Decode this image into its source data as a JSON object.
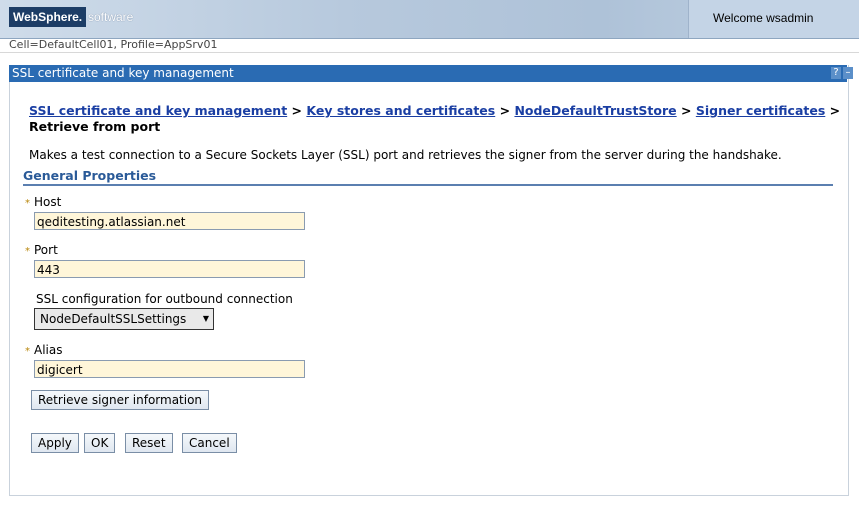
{
  "header": {
    "logo_brand": "WebSphere.",
    "logo_software": "software",
    "welcome": "Welcome wsadmin"
  },
  "context": {
    "cell_profile": "Cell=DefaultCell01, Profile=AppSrv01"
  },
  "panel": {
    "title": "SSL certificate and key management",
    "help_icon": "?",
    "minimize_icon": "–"
  },
  "breadcrumb": {
    "items": [
      "SSL certificate and key management",
      "Key stores and certificates",
      "NodeDefaultTrustStore",
      "Signer certificates"
    ],
    "separator": ">",
    "current": "Retrieve from port"
  },
  "description": "Makes a test connection to a Secure Sockets Layer (SSL) port and retrieves the signer from the server during the handshake.",
  "general_properties": {
    "title": "General Properties",
    "required_marker": "*",
    "host": {
      "label": "Host",
      "value": "qeditesting.atlassian.net"
    },
    "port": {
      "label": "Port",
      "value": "443"
    },
    "ssl_config": {
      "label": "SSL configuration for outbound connection",
      "selected": "NodeDefaultSSLSettings"
    },
    "alias": {
      "label": "Alias",
      "value": "digicert"
    },
    "retrieve_button": "Retrieve signer information"
  },
  "actions": {
    "apply": "Apply",
    "ok": "OK",
    "reset": "Reset",
    "cancel": "Cancel"
  }
}
